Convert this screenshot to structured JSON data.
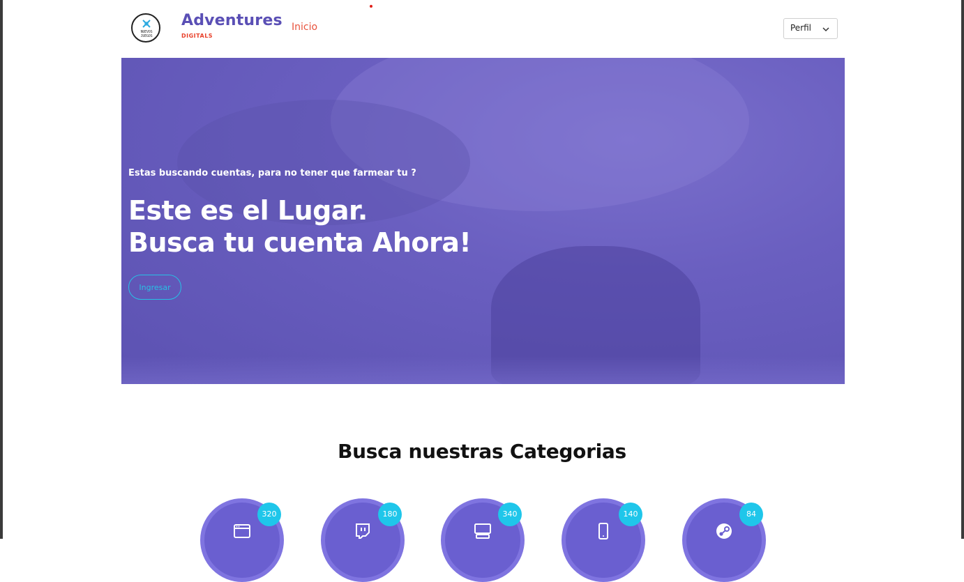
{
  "header": {
    "logo_text": "NUEVOS JUEGOS",
    "brand_title": "Adventures",
    "brand_subtitle": "DIGITALS",
    "nav_inicio": "Inicio",
    "profile_select": "Perfil"
  },
  "hero": {
    "kicker": "Estas buscando cuentas, para no tener que farmear tu ?",
    "headline_line1": "Este es el Lugar.",
    "headline_line2": "Busca tu cuenta Ahora!",
    "cta_label": "Ingresar"
  },
  "categories": {
    "title": "Busca nuestras Categorias",
    "items": [
      {
        "count": "320",
        "icon": "browser-window-icon"
      },
      {
        "count": "180",
        "icon": "twitch-icon"
      },
      {
        "count": "340",
        "icon": "desktop-console-icon"
      },
      {
        "count": "140",
        "icon": "mobile-phone-icon"
      },
      {
        "count": "84",
        "icon": "steam-icon"
      }
    ]
  },
  "colors": {
    "brand_purple": "#5a4fb5",
    "accent_orange": "#e8523c",
    "cta_cyan": "#27c1e6",
    "badge_cyan": "#1fc6ea",
    "hero_overlay": "#6a5fc0"
  }
}
